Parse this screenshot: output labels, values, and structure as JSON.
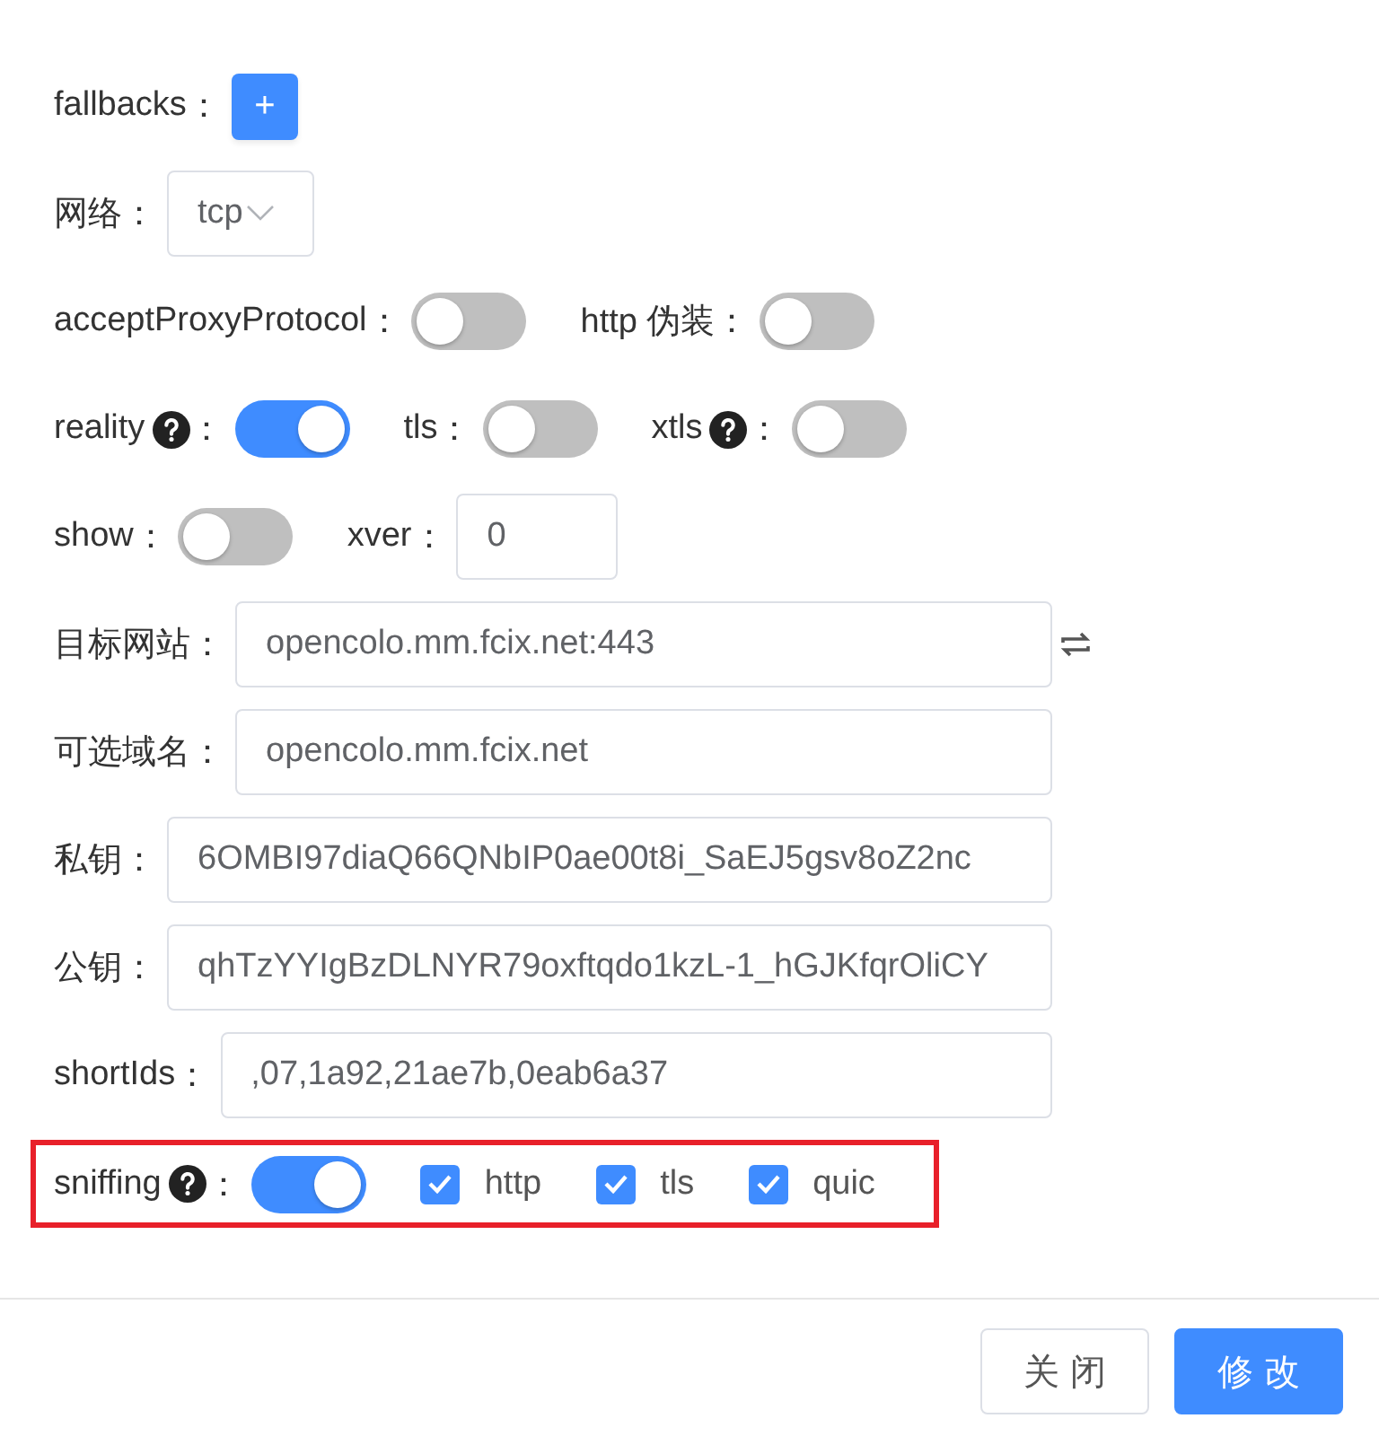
{
  "rows": [
    {
      "highlighted": false,
      "items": [
        {
          "kind": "add",
          "label": "fallbacks",
          "help": false,
          "colon": "：",
          "text": "+"
        }
      ]
    },
    {
      "highlighted": false,
      "items": [
        {
          "kind": "select",
          "label": "网络",
          "help": false,
          "colon": "：",
          "value": "tcp"
        }
      ]
    },
    {
      "highlighted": false,
      "items": [
        {
          "kind": "switch",
          "label": "acceptProxyProtocol",
          "help": false,
          "colon": "：",
          "on": false
        },
        {
          "kind": "switch",
          "label": "http 伪装",
          "help": false,
          "colon": "：",
          "on": false
        }
      ]
    },
    {
      "highlighted": false,
      "items": [
        {
          "kind": "switch",
          "label": "reality",
          "help": true,
          "colon": "：",
          "on": true
        },
        {
          "kind": "switch",
          "label": "tls",
          "help": false,
          "colon": "：",
          "on": false
        },
        {
          "kind": "switch",
          "label": "xtls",
          "help": true,
          "colon": "：",
          "on": false
        }
      ]
    },
    {
      "highlighted": false,
      "items": [
        {
          "kind": "switch",
          "label": "show",
          "help": false,
          "colon": "：",
          "on": false
        },
        {
          "kind": "number",
          "label": "xver",
          "help": false,
          "colon": "：",
          "value": "0"
        }
      ]
    },
    {
      "highlighted": false,
      "items": [
        {
          "kind": "text",
          "label": "目标网站",
          "help": false,
          "colon": "：",
          "value": "opencolo.mm.fcix.net:443",
          "trailing_icon": true
        }
      ]
    },
    {
      "highlighted": false,
      "items": [
        {
          "kind": "text",
          "label": "可选域名",
          "help": false,
          "colon": "：",
          "value": "opencolo.mm.fcix.net"
        }
      ]
    },
    {
      "highlighted": false,
      "items": [
        {
          "kind": "text",
          "label": "私钥",
          "help": false,
          "colon": "：",
          "value": "6OMBI97diaQ66QNbIP0ae00t8i_SaEJ5gsv8oZ2nc"
        }
      ]
    },
    {
      "highlighted": false,
      "items": [
        {
          "kind": "text",
          "label": "公钥",
          "help": false,
          "colon": "：",
          "value": "qhTzYYIgBzDLNYR79oxftqdo1kzL-1_hGJKfqrOliCY"
        }
      ]
    },
    {
      "highlighted": false,
      "items": [
        {
          "kind": "text",
          "label": "shortIds",
          "help": false,
          "colon": "：",
          "value": ",07,1a92,21ae7b,0eab6a37"
        }
      ]
    },
    {
      "highlighted": true,
      "items": [
        {
          "kind": "switch",
          "label": "sniffing",
          "help": true,
          "colon": "：",
          "on": true
        },
        {
          "kind": "checkbox",
          "label": "http",
          "checked": true
        },
        {
          "kind": "checkbox",
          "label": "tls",
          "checked": true
        },
        {
          "kind": "checkbox",
          "label": "quic",
          "checked": true
        }
      ]
    }
  ],
  "footer": {
    "buttons": [
      {
        "label": "关闭",
        "kind": "default"
      },
      {
        "label": "修改",
        "kind": "primary"
      }
    ]
  }
}
